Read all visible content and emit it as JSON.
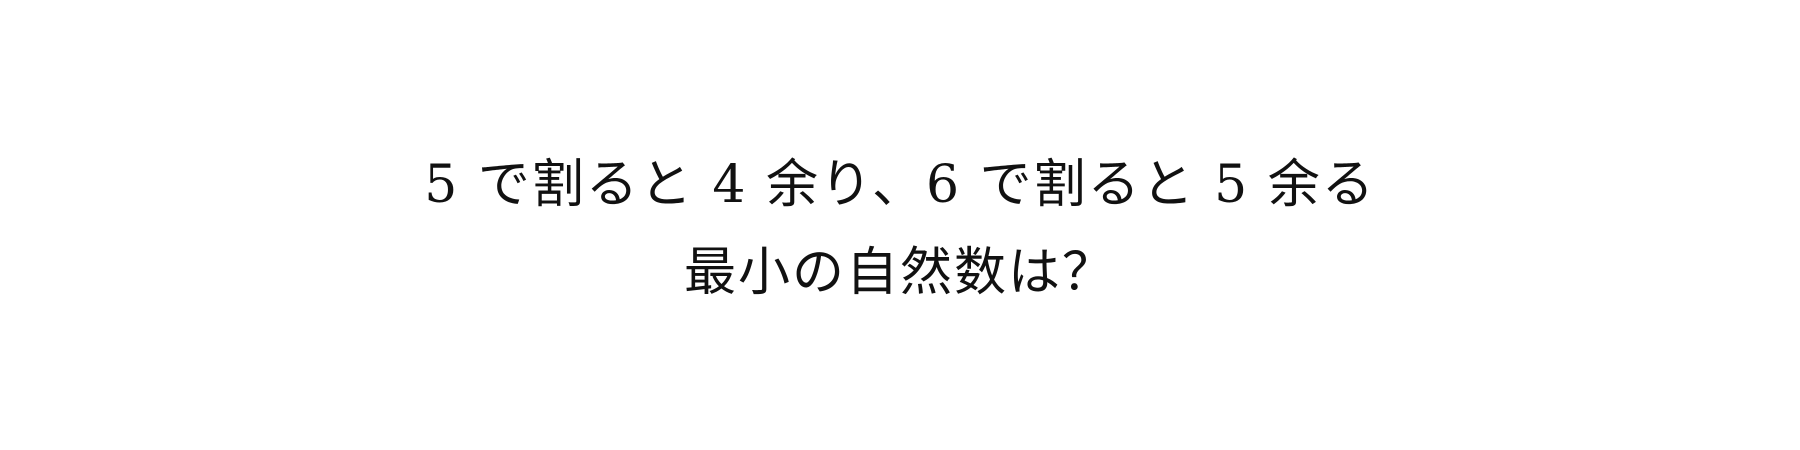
{
  "problem": {
    "line1": "5 で割ると 4 余り、6 で割ると 5 余る",
    "line2": "最小の自然数は？"
  }
}
